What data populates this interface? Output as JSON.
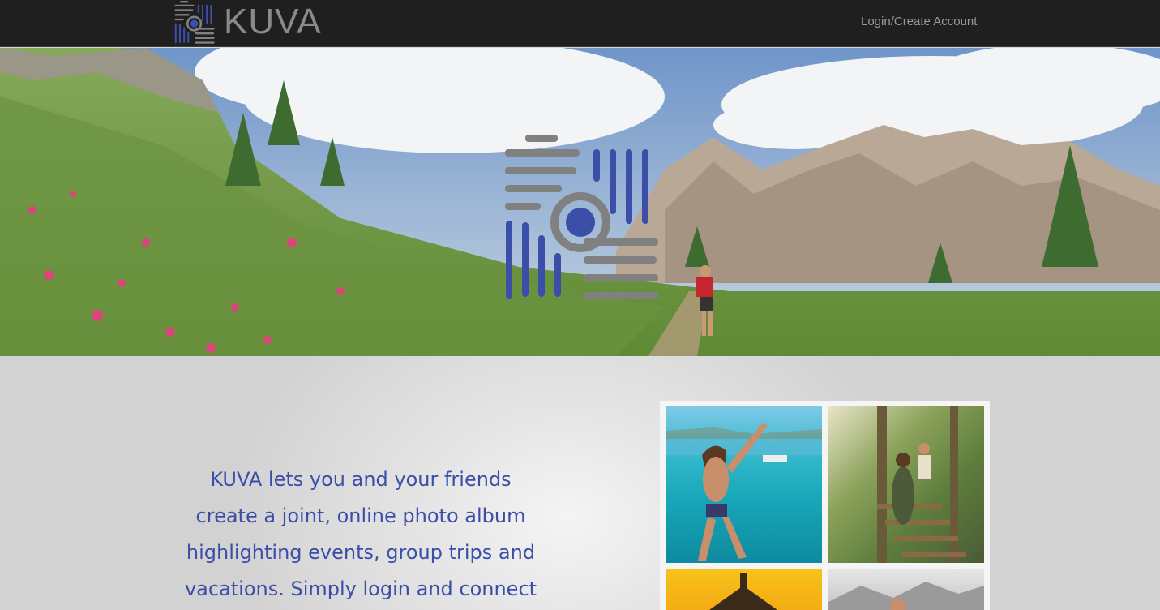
{
  "nav": {
    "brand_name": "KUVA",
    "login_label": "Login/Create Account"
  },
  "hero": {
    "logo_icon": "kuva-camera-logo-icon"
  },
  "main": {
    "tagline_lines": [
      "KUVA lets you and your friends",
      "create a joint, online photo album",
      "highlighting events, group trips and",
      "vacations. Simply login and connect"
    ]
  },
  "colors": {
    "navbar_bg": "#1f1f1f",
    "brand_blue": "#3b4ea8",
    "logo_gray": "#808080"
  }
}
